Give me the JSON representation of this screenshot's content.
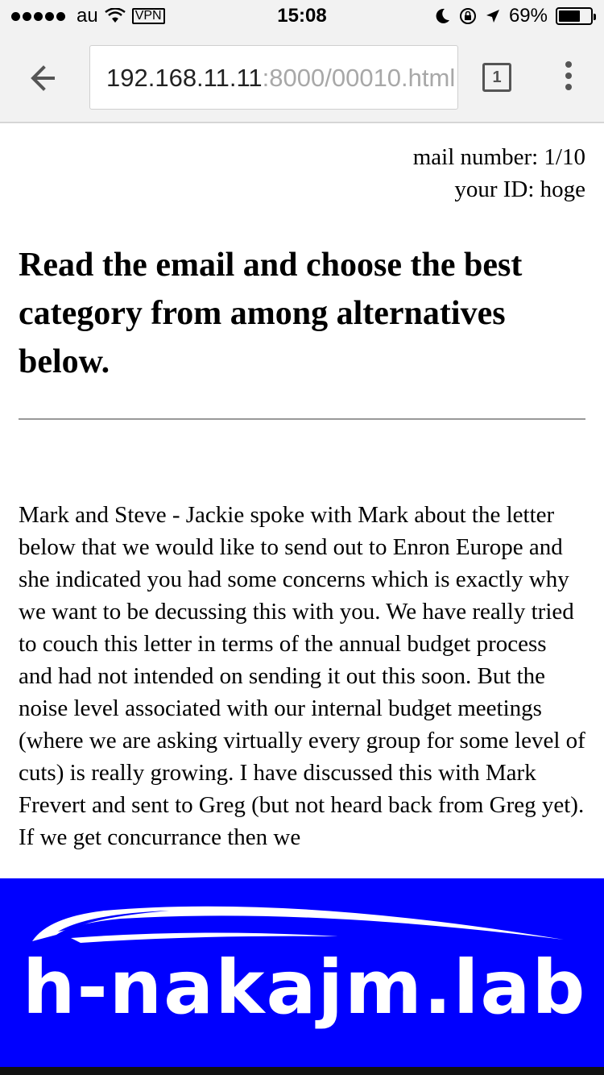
{
  "status_bar": {
    "carrier": "au",
    "vpn": "VPN",
    "time": "15:08",
    "battery": "69%",
    "battery_level": 0.69
  },
  "browser": {
    "url_host": "192.168.11.11",
    "url_rest": ":8000/00010.html",
    "tab_count": "1"
  },
  "page": {
    "mail_number": "mail number: 1/10",
    "your_id": "your ID: hoge",
    "heading": "Read the email and choose the best category from among alternatives below.",
    "mail_body": "Mark and Steve - Jackie spoke with Mark about the letter below that we would like to send out to Enron Europe and she indicated you had some concerns which is exactly why we want to be decussing this with you. We have really tried to couch this letter in terms of the annual budget process and had not intended on sending it out this soon. But the noise level associated with our internal budget meetings (where we are asking virtually every group for some level of cuts) is really growing. I have discussed this with Mark Frevert and sent to Greg (but not heard back from Greg yet). If we get concurrance then we"
  },
  "banner": {
    "logo_text": "h-nakajm.lab",
    "color": "#0000ff"
  }
}
